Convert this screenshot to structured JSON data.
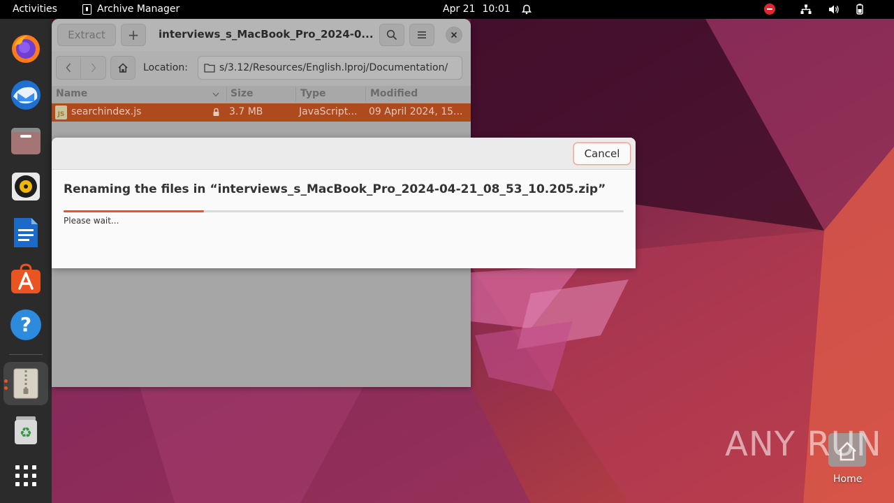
{
  "topbar": {
    "activities": "Activities",
    "app_name": "Archive Manager",
    "date": "Apr 21",
    "time": "10:01"
  },
  "dock": {
    "items": [
      "Firefox",
      "Thunderbird",
      "Files",
      "Rhythmbox",
      "LibreOffice Writer",
      "Ubuntu Software",
      "Help",
      "Archive Manager",
      "Trash",
      "Show Applications"
    ],
    "active_item": "Archive Manager"
  },
  "window": {
    "extract_label": "Extract",
    "add_label": "+",
    "title": "interviews_s_MacBook_Pro_2024-0...",
    "location_label": "Location:",
    "location_value": "s/3.12/Resources/English.lproj/Documentation/",
    "columns": [
      "Name",
      "Size",
      "Type",
      "Modified"
    ],
    "files": [
      {
        "name": "searchindex.js",
        "icon_text": "JS",
        "size": "3.7 MB",
        "type": "JavaScript...",
        "modified": "09 April 2024, 15..."
      }
    ]
  },
  "dialog": {
    "cancel_label": "Cancel",
    "message": "Renaming the files in “interviews_s_MacBook_Pro_2024-04-21_08_53_10.205.zip”",
    "progress_fraction": 0.25,
    "status": "Please wait..."
  },
  "desktop": {
    "home_label": "Home",
    "watermark": "ANY RUN"
  },
  "colors": {
    "accent": "#e95420",
    "selection": "#af4a1e",
    "dock_bg": "#2b2b2b",
    "topbar_bg": "#000000"
  }
}
